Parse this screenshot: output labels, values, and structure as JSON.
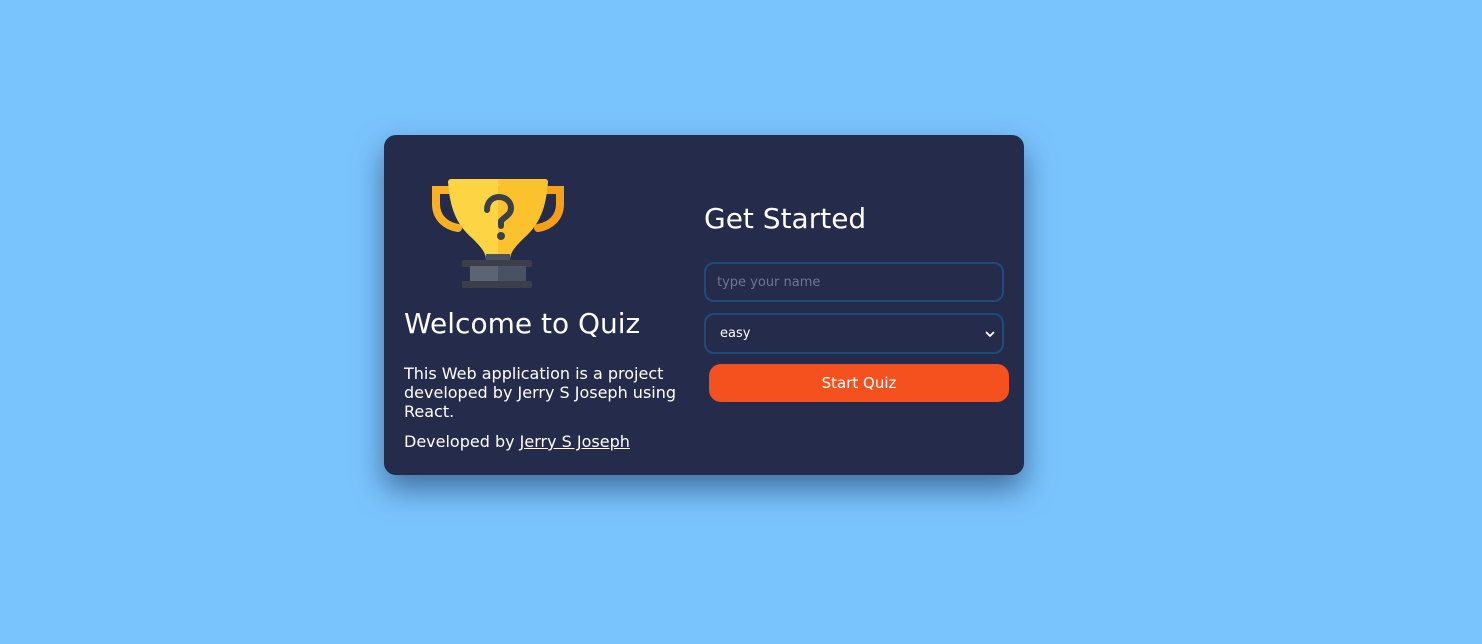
{
  "welcome": {
    "title": "Welcome to Quiz",
    "description": "This Web application is a project developed by Jerry S Joseph using React.",
    "credit_prefix": "Developed by",
    "credit_link": "Jerry S Joseph"
  },
  "form": {
    "title": "Get Started",
    "name_placeholder": "type your name",
    "name_value": "",
    "difficulty_selected": "easy",
    "start_label": "Start Quiz"
  },
  "icons": {
    "trophy": "trophy-question-icon",
    "select_arrow": "chevron-down-icon"
  },
  "colors": {
    "page_background": "#7ac4fe",
    "card_background": "#252c4b",
    "accent_button": "#f5511e",
    "input_border": "#1f4b79",
    "trophy_gold": "#fdd443"
  }
}
